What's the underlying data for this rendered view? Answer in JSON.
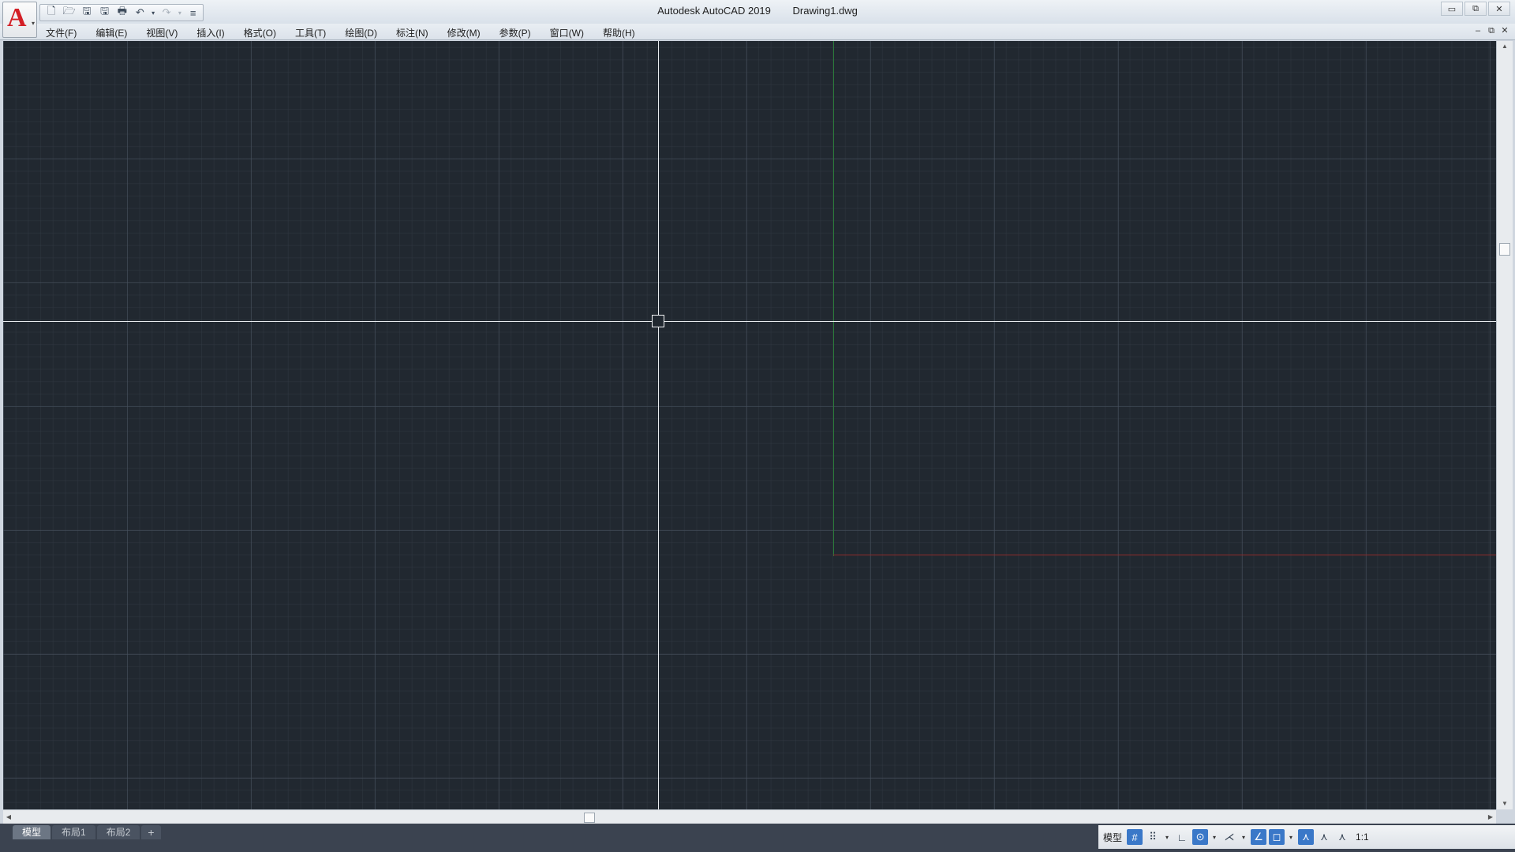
{
  "window": {
    "app_title": "Autodesk AutoCAD 2019",
    "file_name": "Drawing1.dwg",
    "controls": {
      "minimize": "▭",
      "restore": "⧉",
      "close": "✕"
    }
  },
  "app_button": {
    "logo": "A",
    "caret": "▾"
  },
  "quick_access": {
    "new": "🗋",
    "open": "🗁",
    "save": "🖫",
    "save_as": "🖫",
    "plot": "🖶",
    "undo": "↶",
    "redo": "↷",
    "dropdown": "▾",
    "customize": "≡"
  },
  "menu": {
    "items": [
      "文件(F)",
      "编辑(E)",
      "视图(V)",
      "插入(I)",
      "格式(O)",
      "工具(T)",
      "绘图(D)",
      "标注(N)",
      "修改(M)",
      "参数(P)",
      "窗口(W)",
      "帮助(H)"
    ]
  },
  "doc_controls": {
    "minimize": "–",
    "restore": "⧉",
    "close": "✕"
  },
  "scroll": {
    "up": "▲",
    "down": "▼",
    "left": "◀",
    "right": "▶"
  },
  "layout_tabs": {
    "model": "模型",
    "layout1": "布局1",
    "layout2": "布局2",
    "add": "+"
  },
  "status": {
    "model_label": "模型",
    "grid": "#",
    "snap": "⠿",
    "dropdown": "▾",
    "ortho": "∟",
    "polar": "⊙",
    "isodraft": "⋌",
    "osnap_track": "∠",
    "osnap": "◻",
    "annot_visibility": "⋏",
    "auto_scale": "⋏",
    "annot_scale": "⋏",
    "scale": "1:1"
  },
  "colors": {
    "canvas_bg": "#212830",
    "y_axis": "#2b7a3a",
    "x_axis": "#8e2a2a",
    "crosshair": "#e9ecef",
    "status_active": "#3a78c8",
    "logo_red": "#d31f26"
  }
}
